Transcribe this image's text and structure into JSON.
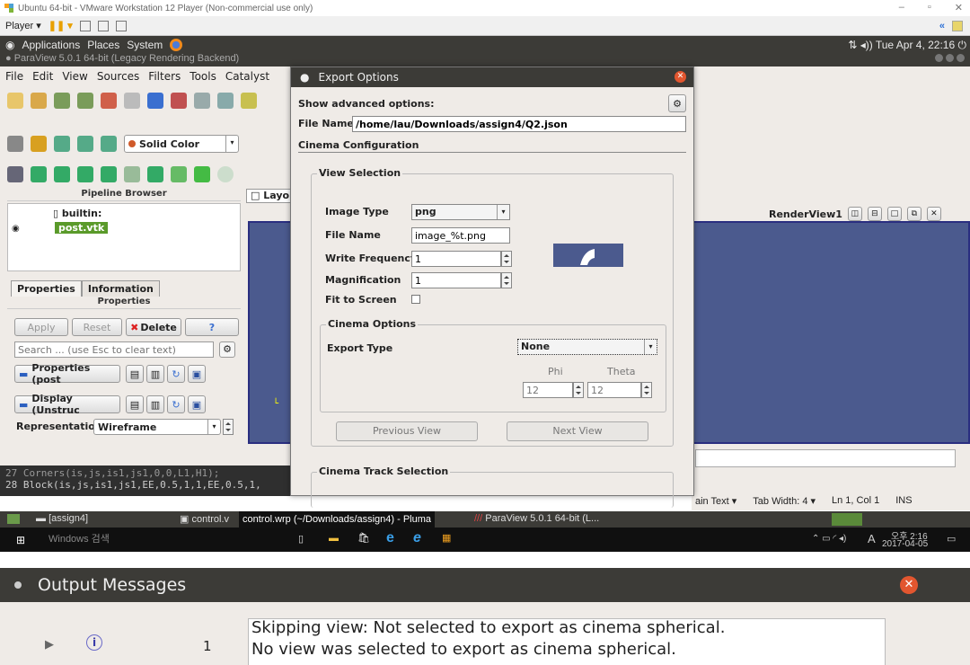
{
  "vm": {
    "title": "Ubuntu 64-bit - VMware Workstation 12 Player (Non-commercial use only)",
    "player_menu": "Player ▾"
  },
  "gnome": {
    "applications": "Applications",
    "places": "Places",
    "system": "System",
    "clock": "Tue Apr 4, 22:16",
    "pv_title": "ParaView 5.0.1 64-bit (Legacy Rendering Backend)"
  },
  "paraview": {
    "menus": [
      "File",
      "Edit",
      "View",
      "Sources",
      "Filters",
      "Tools",
      "Catalyst"
    ],
    "solid_color": "Solid Color",
    "pipeline_browser": "Pipeline Browser",
    "layout_tab": "Layo",
    "builtin": "builtin:",
    "post": "post.vtk",
    "tab_properties": "Properties",
    "tab_information": "Information",
    "properties_header": "Properties",
    "apply": "Apply",
    "reset": "Reset",
    "delete": "Delete",
    "help": "?",
    "search_placeholder": "Search ... (use Esc to clear text)",
    "properties_post": "Properties (post",
    "display_unstruc": "Display (Unstruc",
    "representation_label": "Representation",
    "representation_value": "Wireframe",
    "renderview": "RenderView1",
    "terminal_lines": [
      "27 Corners(is,js,is1,js1,0,0,L1,H1);",
      "28 Block(is,js,is1,js1,EE,0.5,1,1,EE,0.5,1,"
    ],
    "pluma_status": [
      "ain Text ▾",
      "Tab Width: 4 ▾",
      "Ln 1, Col 1",
      "INS"
    ]
  },
  "dialog": {
    "title": "Export Options",
    "show_advanced": "Show advanced options:",
    "file_name_label": "File Name",
    "file_name_value": "/home/lau/Downloads/assign4/Q2.json",
    "cinema_config": "Cinema Configuration",
    "view_selection": "View Selection",
    "image_type_label": "Image Type",
    "image_type_value": "png",
    "file_name2_label": "File Name",
    "file_name2_value": "image_%t.png",
    "write_freq_label": "Write Frequency",
    "write_freq_value": "1",
    "magnification_label": "Magnification",
    "magnification_value": "1",
    "fit_to_screen_label": "Fit to Screen",
    "cinema_options": "Cinema Options",
    "export_type_label": "Export Type",
    "export_type_value": "None",
    "phi_label": "Phi",
    "theta_label": "Theta",
    "phi_value": "12",
    "theta_value": "12",
    "prev_view": "Previous View",
    "next_view": "Next View",
    "cinema_track": "Cinema Track Selection"
  },
  "taskbar": {
    "item1": "[assign4]",
    "item2": "control.v",
    "tooltip": "control.wrp (~/Downloads/assign4) - Pluma",
    "item3": "ParaView 5.0.1 64-bit (L..."
  },
  "windows": {
    "search": "Windows 검색",
    "time": "오후 2:16",
    "date": "2017-04-05",
    "ime": "A"
  },
  "output": {
    "title": "Output Messages",
    "count": "1",
    "line1": "Skipping view: Not selected to export as cinema spherical.",
    "line2": "No view was selected to export as cinema spherical."
  },
  "colors": {
    "accent_orange": "#e2562f",
    "dark_panel": "#3c3b37",
    "render_bg": "#4b5a8e"
  }
}
